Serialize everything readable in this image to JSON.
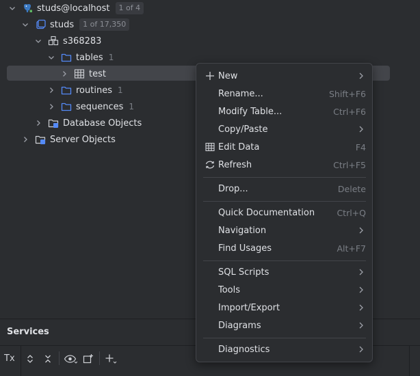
{
  "tree": {
    "items": [
      {
        "label": "studs@localhost",
        "badge": "1 of 4"
      },
      {
        "label": "studs",
        "badge": "1 of 17,350"
      },
      {
        "label": "s368283"
      },
      {
        "label": "tables",
        "count": "1"
      },
      {
        "label": "test"
      },
      {
        "label": "routines",
        "count": "1"
      },
      {
        "label": "sequences",
        "count": "1"
      },
      {
        "label": "Database Objects"
      },
      {
        "label": "Server Objects"
      }
    ]
  },
  "menu": {
    "new": {
      "label": "New"
    },
    "rename": {
      "label": "Rename...",
      "shortcut": "Shift+F6"
    },
    "modify": {
      "label": "Modify Table...",
      "shortcut": "Ctrl+F6"
    },
    "copy_paste": {
      "label": "Copy/Paste"
    },
    "edit_data": {
      "label": "Edit Data",
      "shortcut": "F4"
    },
    "refresh": {
      "label": "Refresh",
      "shortcut": "Ctrl+F5"
    },
    "drop": {
      "label": "Drop...",
      "shortcut": "Delete"
    },
    "quick_doc": {
      "label": "Quick Documentation",
      "shortcut": "Ctrl+Q"
    },
    "navigation": {
      "label": "Navigation"
    },
    "find_usages": {
      "label": "Find Usages",
      "shortcut": "Alt+F7"
    },
    "sql_scripts": {
      "label": "SQL Scripts"
    },
    "tools": {
      "label": "Tools"
    },
    "import_export": {
      "label": "Import/Export"
    },
    "diagrams": {
      "label": "Diagrams"
    },
    "diagnostics": {
      "label": "Diagnostics"
    }
  },
  "services": {
    "title": "Services",
    "tx_label": "Tx"
  },
  "colors": {
    "background": "#2b2d30",
    "selection": "#43454a",
    "folder_blue": "#548af7",
    "text": "#dfe1e5",
    "muted": "#7a7e85"
  }
}
